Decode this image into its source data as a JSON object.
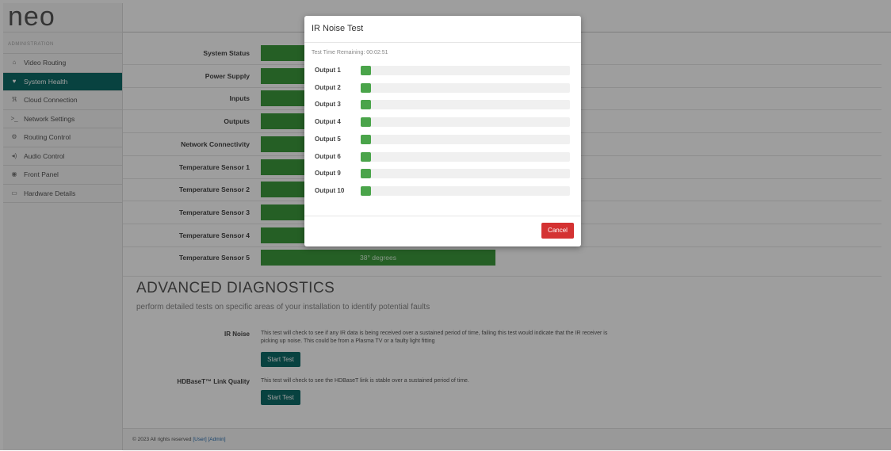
{
  "app": {
    "logo_text": "neo",
    "sidebar_section": "ADMINISTRATION",
    "nav": [
      {
        "label": "Video Routing",
        "icon": "home-icon",
        "glyph": "⌂",
        "active": false
      },
      {
        "label": "System Health",
        "icon": "heart-icon",
        "glyph": "♥",
        "active": true
      },
      {
        "label": "Cloud Connection",
        "icon": "rss-icon",
        "glyph": "ℜ",
        "active": false
      },
      {
        "label": "Network Settings",
        "icon": "terminal-icon",
        "glyph": ">_",
        "active": false
      },
      {
        "label": "Routing Control",
        "icon": "cogs-icon",
        "glyph": "⚙",
        "active": false
      },
      {
        "label": "Audio Control",
        "icon": "volume-icon",
        "glyph": "◂)",
        "active": false
      },
      {
        "label": "Front Panel",
        "icon": "eye-icon",
        "glyph": "◉",
        "active": false
      },
      {
        "label": "Hardware Details",
        "icon": "hdd-icon",
        "glyph": "▭",
        "active": false
      }
    ]
  },
  "status": {
    "rows": [
      {
        "label": "System Status",
        "value": ""
      },
      {
        "label": "Power Supply",
        "value": ""
      },
      {
        "label": "Inputs",
        "value": ""
      },
      {
        "label": "Outputs",
        "value": ""
      },
      {
        "label": "Network Connectivity",
        "value": ""
      },
      {
        "label": "Temperature Sensor 1",
        "value": ""
      },
      {
        "label": "Temperature Sensor 2",
        "value": ""
      },
      {
        "label": "Temperature Sensor 3",
        "value": ""
      },
      {
        "label": "Temperature Sensor 4",
        "value": ""
      },
      {
        "label": "Temperature Sensor 5",
        "value": "38° degrees"
      }
    ],
    "bar_color": "#3c9a3c"
  },
  "advanced": {
    "title": "ADVANCED DIAGNOSTICS",
    "subtitle": "perform detailed tests on specific areas of your installation to identify potential faults",
    "tests": [
      {
        "label": "IR Noise",
        "description": "This test will check to see if any IR data is being received over a sustained period of time, failing this test would indicate that the IR receiver is picking up noise. This could be from a Plasma TV or a faulty light fitting",
        "button": "Start Test"
      },
      {
        "label": "HDBaseT™ Link Quality",
        "description": "This test will check to see the HDBaseT link is stable over a sustained period of time.",
        "button": "Start Test"
      }
    ]
  },
  "footer": {
    "text": "© 2023 All rights reserved",
    "link_user": "[User]",
    "link_admin": "[Admin]"
  },
  "modal": {
    "title": "IR Noise Test",
    "remaining": "Test Time Remaining: 00:02:51",
    "outputs": [
      {
        "label": "Output 1",
        "progress": 0.05
      },
      {
        "label": "Output 2",
        "progress": 0.05
      },
      {
        "label": "Output 3",
        "progress": 0.05
      },
      {
        "label": "Output 4",
        "progress": 0.05
      },
      {
        "label": "Output 5",
        "progress": 0.05
      },
      {
        "label": "Output 6",
        "progress": 0.05
      },
      {
        "label": "Output 9",
        "progress": 0.05
      },
      {
        "label": "Output 10",
        "progress": 0.05
      }
    ],
    "cancel_label": "Cancel",
    "progress_color": "#4aa44a",
    "cancel_color": "#d43232"
  }
}
